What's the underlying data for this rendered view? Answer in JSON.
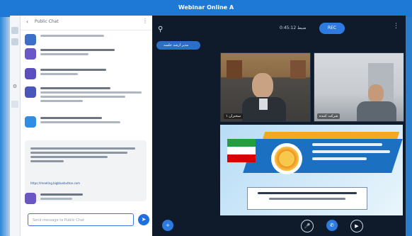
{
  "window": {
    "title": "Webinar Online A"
  },
  "chat": {
    "title": "Public Chat",
    "input_placeholder": "Send message to Public Chat",
    "link_text": "https://meeting.bigbluebutton.com"
  },
  "session": {
    "user_label": "مدیر ارشد جلسه",
    "timer": "ضبط 0:45:12",
    "record_label": "REC"
  },
  "videos": [
    {
      "name": "سخنران ۱"
    },
    {
      "name": "شرکت کننده"
    }
  ],
  "colors": {
    "accent": "#1f6fe0",
    "background_dark": "#0f1b2a",
    "chat_bg": "#ffffff"
  }
}
